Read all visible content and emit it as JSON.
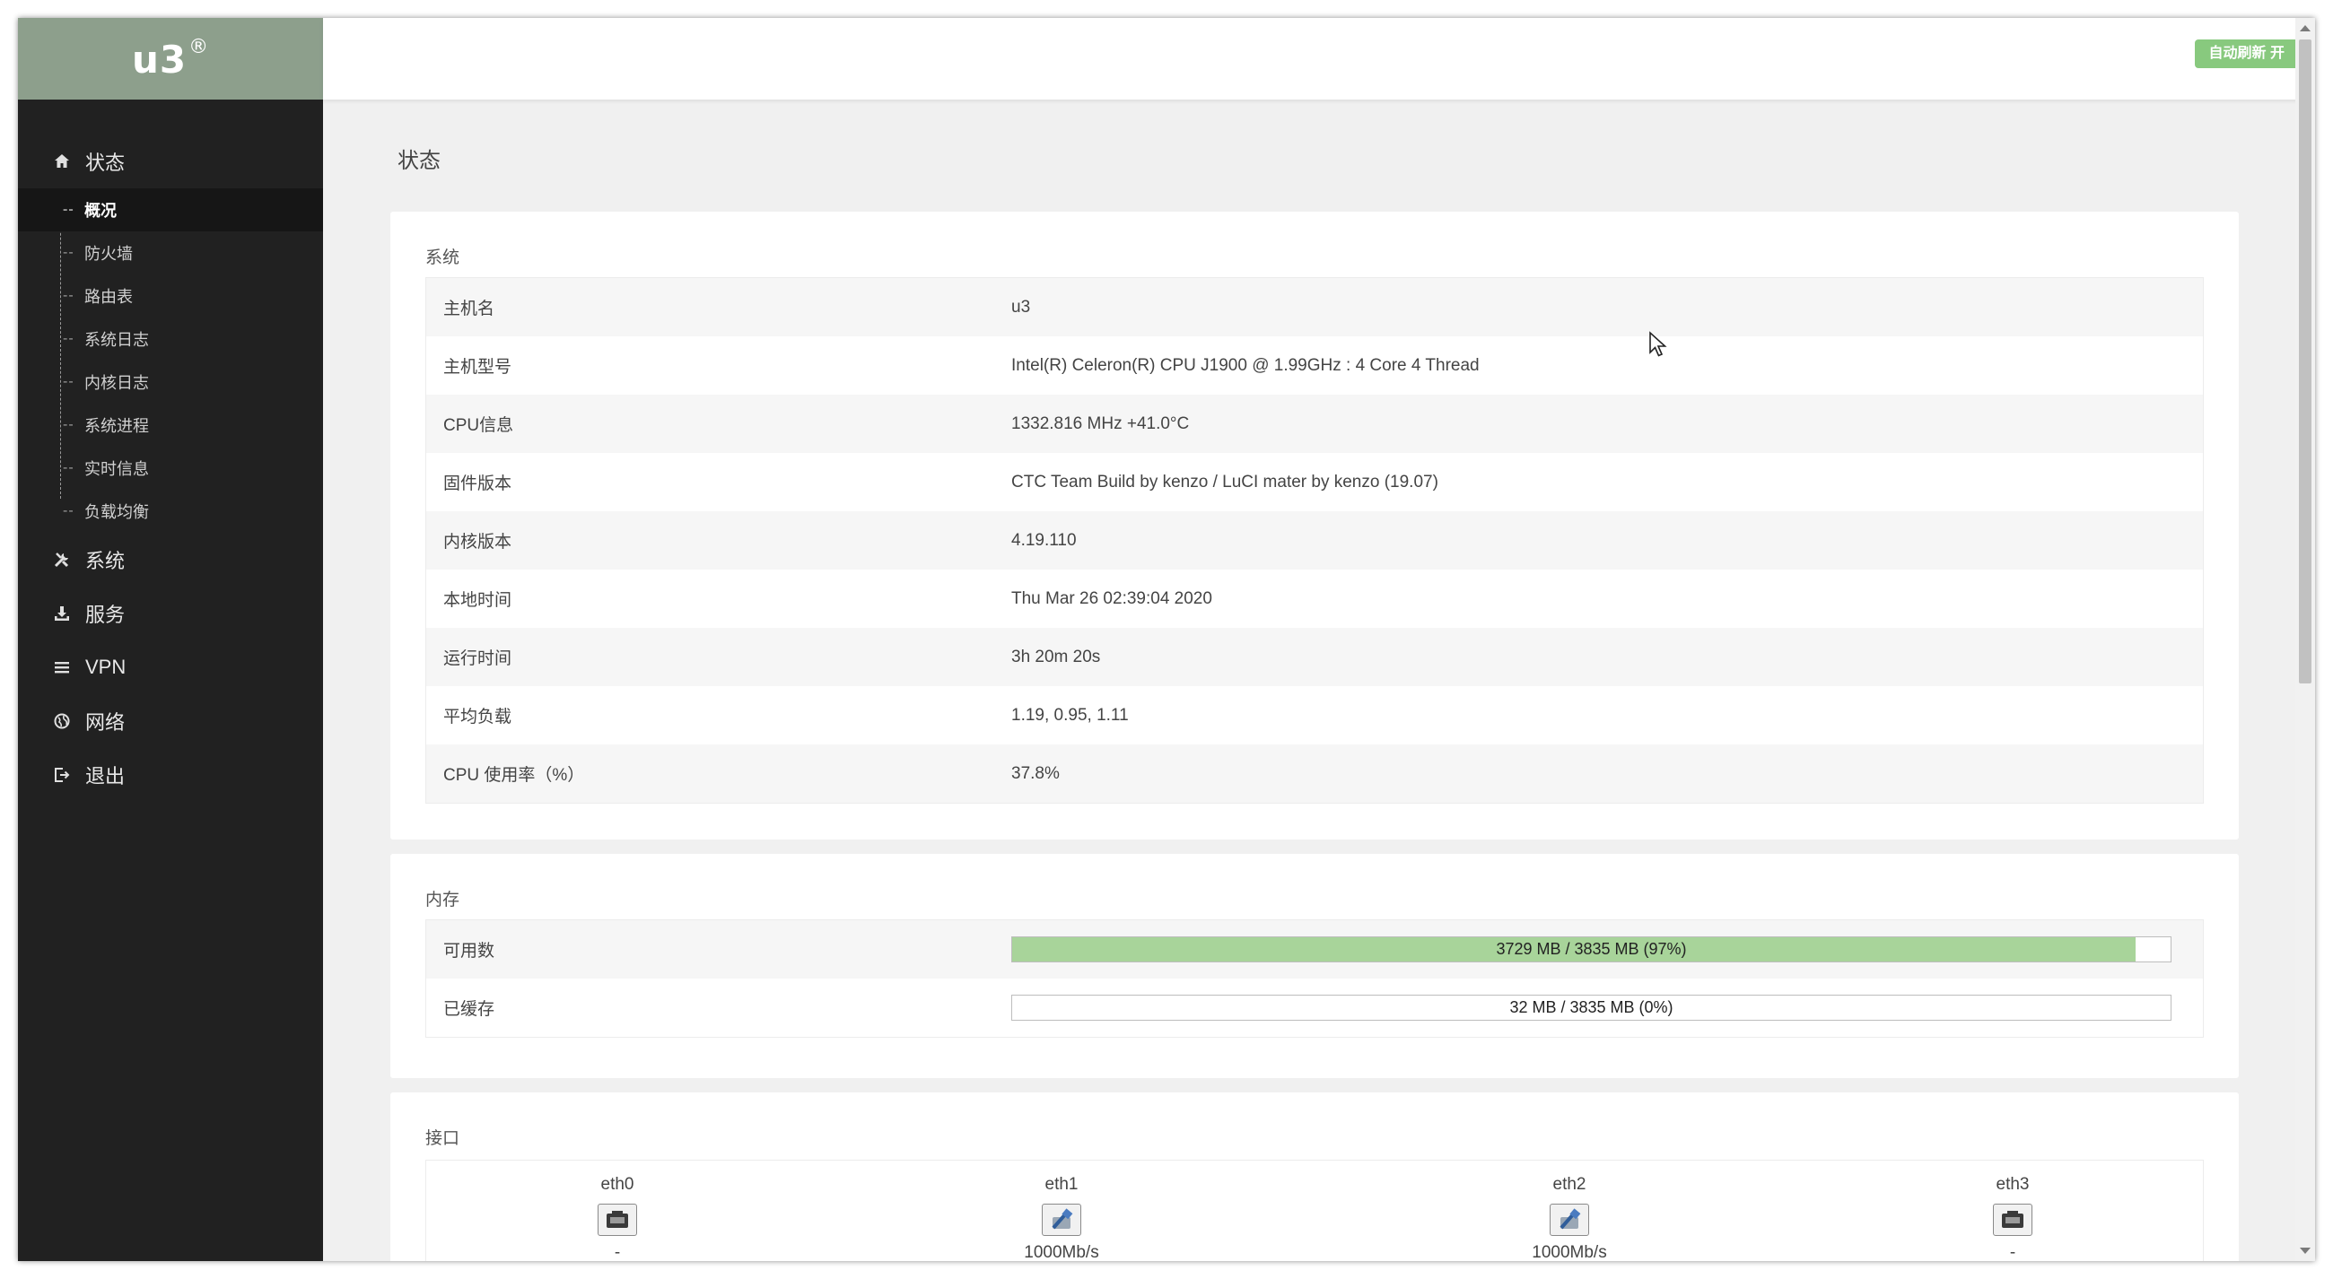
{
  "app": {
    "logo": "u3",
    "logo_mark": "®",
    "auto_refresh": "自动刷新 开"
  },
  "sidebar": {
    "items": [
      {
        "label": "状态",
        "icon": "home-icon"
      },
      {
        "label": "系统",
        "icon": "tools-icon"
      },
      {
        "label": "服务",
        "icon": "download-icon"
      },
      {
        "label": "VPN",
        "icon": "list-icon"
      },
      {
        "label": "网络",
        "icon": "globe-icon"
      },
      {
        "label": "退出",
        "icon": "logout-icon"
      }
    ],
    "submenu": [
      "概况",
      "防火墙",
      "路由表",
      "系统日志",
      "内核日志",
      "系统进程",
      "实时信息",
      "负载均衡"
    ],
    "active_submenu": "概况"
  },
  "page": {
    "title": "状态"
  },
  "system": {
    "title": "系统",
    "rows": [
      {
        "key": "主机名",
        "value": "u3"
      },
      {
        "key": "主机型号",
        "value": "Intel(R) Celeron(R) CPU J1900 @ 1.99GHz : 4 Core 4 Thread"
      },
      {
        "key": "CPU信息",
        "value": "1332.816 MHz +41.0°C"
      },
      {
        "key": "固件版本",
        "value": "CTC Team Build by kenzo / LuCI mater by kenzo (19.07)"
      },
      {
        "key": "内核版本",
        "value": "4.19.110"
      },
      {
        "key": "本地时间",
        "value": "Thu Mar 26 02:39:04 2020"
      },
      {
        "key": "运行时间",
        "value": "3h 20m 20s"
      },
      {
        "key": "平均负载",
        "value": "1.19, 0.95, 1.11"
      },
      {
        "key": "CPU 使用率（%）",
        "value": "37.8%"
      }
    ]
  },
  "memory": {
    "title": "内存",
    "rows": [
      {
        "key": "可用数",
        "text": "3729 MB / 3835 MB (97%)",
        "fraction": 0.97
      },
      {
        "key": "已缓存",
        "text": "32 MB / 3835 MB (0%)",
        "fraction": 0.0
      }
    ]
  },
  "interfaces": {
    "title": "接口",
    "items": [
      {
        "name": "eth0",
        "speed": "-",
        "link": false
      },
      {
        "name": "eth1",
        "speed": "1000Mb/s",
        "link": true
      },
      {
        "name": "eth2",
        "speed": "1000Mb/s",
        "link": true
      },
      {
        "name": "eth3",
        "speed": "-",
        "link": false
      }
    ]
  },
  "colors": {
    "sidebar_bg": "#212121",
    "logo_bar": "#8d9f8c",
    "badge": "#88c97e",
    "bar_fill": "#a8d49a"
  }
}
